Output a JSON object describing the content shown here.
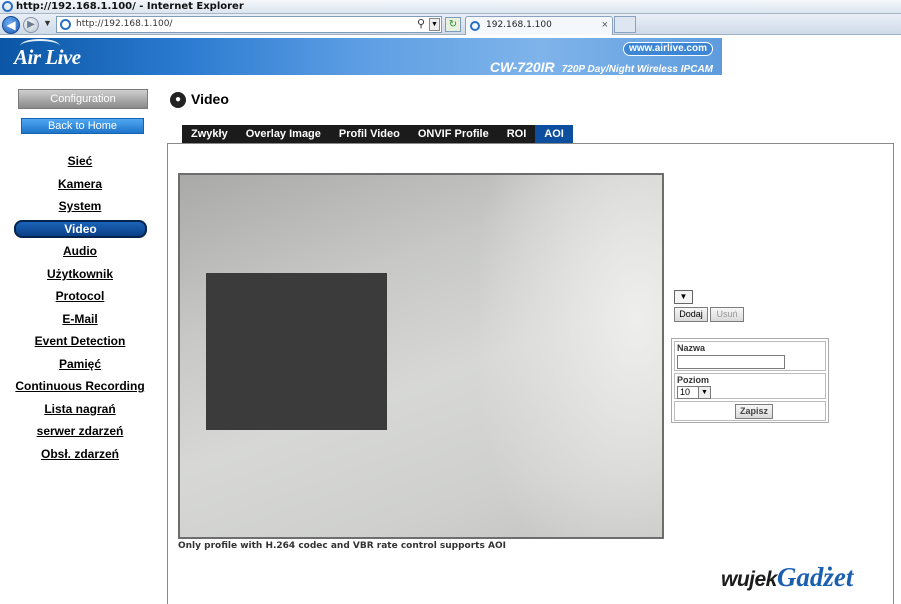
{
  "browser": {
    "window_title": "http://192.168.1.100/ - Internet Explorer",
    "address": "http://192.168.1.100/",
    "tab_title": "192.168.1.100",
    "tab_close": "×"
  },
  "header": {
    "logo": "Air Live",
    "website": "www.airlive.com",
    "model": "CW-720IR",
    "model_desc": "720P Day/Night Wireless IPCAM"
  },
  "sidebar": {
    "config_label": "Configuration",
    "home_label": "Back to Home",
    "items": [
      {
        "label": "Sieć"
      },
      {
        "label": "Kamera"
      },
      {
        "label": "System"
      },
      {
        "label": "Video",
        "active": true
      },
      {
        "label": "Audio"
      },
      {
        "label": "Użytkownik"
      },
      {
        "label": "Protocol"
      },
      {
        "label": "E-Mail"
      },
      {
        "label": "Event Detection"
      },
      {
        "label": "Pamięć"
      },
      {
        "label": "Continuous Recording"
      },
      {
        "label": "Lista nagrań"
      },
      {
        "label": "serwer zdarzeń"
      },
      {
        "label": "Obsł. zdarzeń"
      }
    ]
  },
  "main": {
    "title": "Video",
    "tabs": [
      {
        "label": "Zwykły"
      },
      {
        "label": "Overlay Image"
      },
      {
        "label": "Profil Video"
      },
      {
        "label": "ONVIF Profile"
      },
      {
        "label": "ROI"
      },
      {
        "label": "AOI",
        "active": true
      }
    ],
    "note": "Only profile with H.264 codec and VBR rate control supports AOI",
    "controls": {
      "add_label": "Dodaj",
      "delete_label": "Usuń",
      "name_label": "Nazwa",
      "name_value": "",
      "level_label": "Poziom",
      "level_value": "10",
      "save_label": "Zapisz"
    }
  },
  "watermark": {
    "part1": "wujek",
    "part2": "Gadżet"
  },
  "colors": {
    "accent": "#0b4f9e",
    "banner": "#2a7ad0",
    "aoi_region": "#3b3b3b"
  }
}
